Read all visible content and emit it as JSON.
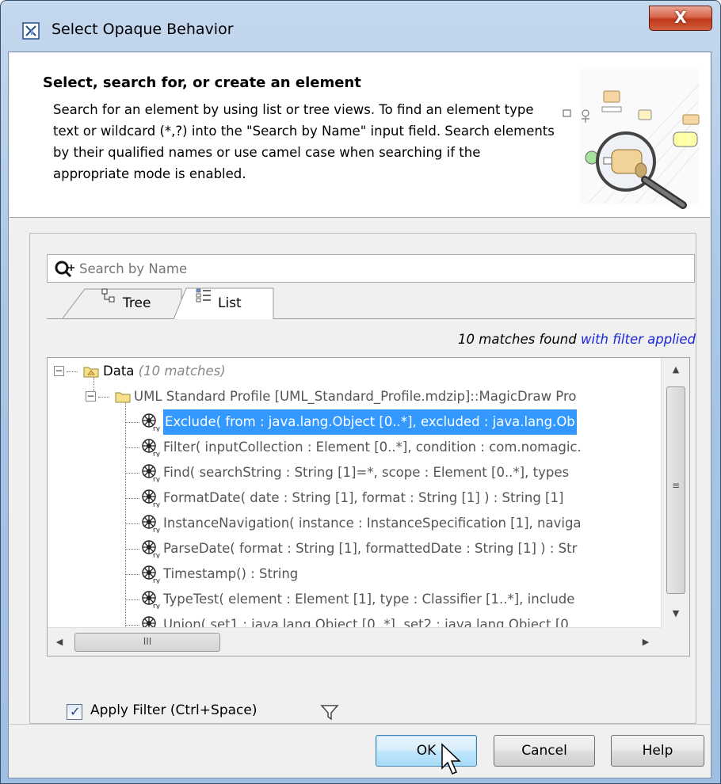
{
  "window": {
    "title": "Select Opaque Behavior",
    "close_label": "X"
  },
  "header": {
    "title": "Select, search for, or create an element",
    "description": "Search for an element by using list or tree views. To find an element type text or wildcard (*,?) into the \"Search by Name\" input field. Search elements by their qualified names or use camel case when searching if the appropriate mode is enabled."
  },
  "search": {
    "placeholder": "Search by Name",
    "value": ""
  },
  "tabs": [
    {
      "label": "Tree",
      "icon": "tree-view-icon",
      "active": false
    },
    {
      "label": "List",
      "icon": "list-view-icon",
      "active": true
    }
  ],
  "match_info": {
    "count": "10 matches found",
    "filter": "with filter applied"
  },
  "tree": {
    "root": {
      "label": "Data",
      "note": "(10 matches)"
    },
    "profile": {
      "label": "UML Standard Profile [UML_Standard_Profile.mdzip]::MagicDraw Pro"
    },
    "items": [
      {
        "label": "Exclude( from : java.lang.Object [0..*], excluded : java.lang.Ob",
        "selected": true
      },
      {
        "label": "Filter( inputCollection : Element [0..*], condition : com.nomagic.",
        "selected": false
      },
      {
        "label": "Find( searchString : String [1]=*, scope : Element [0..*], types",
        "selected": false
      },
      {
        "label": "FormatDate( date : String [1], format : String [1] ) : String [1]",
        "selected": false
      },
      {
        "label": "InstanceNavigation( instance : InstanceSpecification [1], naviga",
        "selected": false
      },
      {
        "label": "ParseDate( format : String [1], formattedDate : String [1] ) : Str",
        "selected": false
      },
      {
        "label": "Timestamp() : String",
        "selected": false
      },
      {
        "label": "TypeTest( element : Element [1], type : Classifier [1..*], include",
        "selected": false
      },
      {
        "label": "Union( set1 : java.lang.Object [0..*], set2 : java.lang.Object [0",
        "selected": false
      }
    ],
    "hscroll_grip": "III",
    "vscroll_grip": "≡"
  },
  "apply_filter": {
    "label": "Apply Filter (Ctrl+Space)",
    "checked": true
  },
  "buttons": {
    "ok": "OK",
    "cancel": "Cancel",
    "help": "Help"
  },
  "colors": {
    "selection": "#3399ff",
    "link": "#1a28d8",
    "close": "#c0391c"
  }
}
